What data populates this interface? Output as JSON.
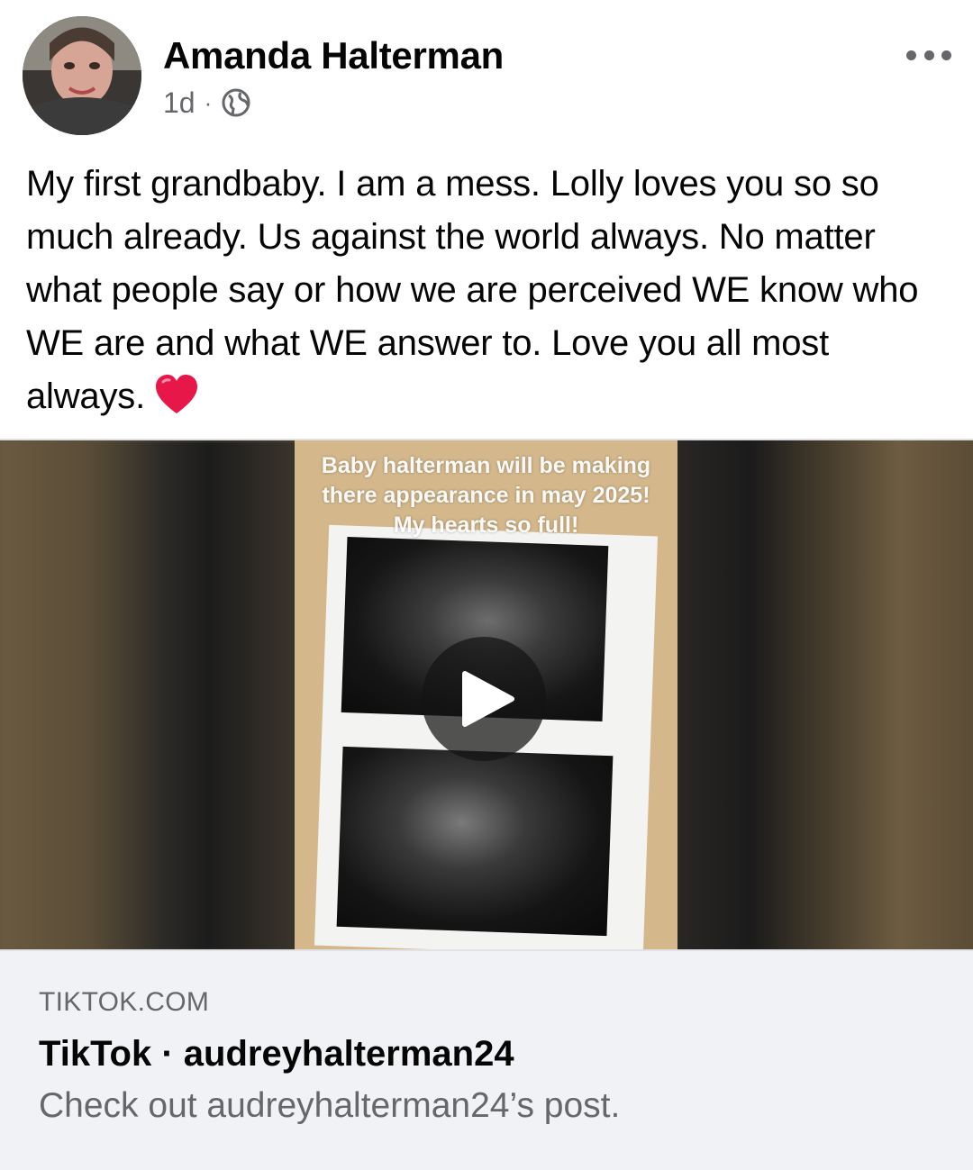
{
  "post": {
    "author_name": "Amanda Halterman",
    "time_ago": "1d",
    "separator": "·",
    "audience_icon": "globe-icon",
    "more_icon": "more-options-icon",
    "text": "My first grandbaby. I am a mess. Lolly loves you so so much already. Us against the world always. No matter what people say or how we are perceived WE know who WE are and what WE answer to. Love you all most always.",
    "emoji": "heart-emoji"
  },
  "media": {
    "overlay_caption": "Baby halterman will be making there appearance in may 2025! My hearts so full!",
    "play_icon": "play-icon"
  },
  "link_preview": {
    "domain": "TIKTOK.COM",
    "title": "TikTok · audreyhalterman24",
    "description": "Check out audreyhalterman24’s post."
  },
  "colors": {
    "primary_text": "#050505",
    "secondary_text": "#65676b",
    "card_background": "#f0f2f5",
    "heart": "#e8174a"
  }
}
